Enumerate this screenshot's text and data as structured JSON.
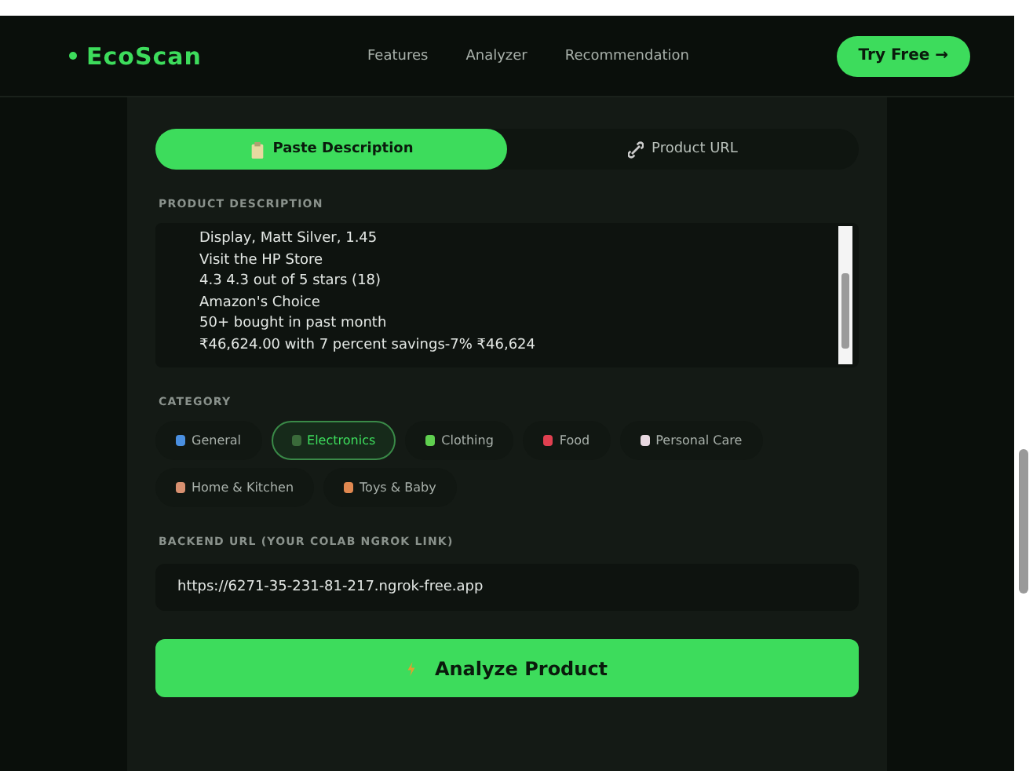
{
  "header": {
    "logo": "EcoScan",
    "nav": [
      "Features",
      "Analyzer",
      "Recommendation"
    ],
    "cta": "Try Free →"
  },
  "tabs": [
    {
      "label": "Paste Description",
      "selected": true
    },
    {
      "label": "Product URL",
      "selected": false
    }
  ],
  "description": {
    "label": "PRODUCT DESCRIPTION",
    "lines": [
      "Display, Matt Silver, 1.45",
      "Visit the HP Store",
      "4.3 4.3 out of 5 stars  (18)",
      "Amazon's Choice",
      "50+ bought in past month",
      "₹46,624.00 with 7 percent savings-7% ₹46,624"
    ]
  },
  "category": {
    "label": "CATEGORY",
    "chips": [
      {
        "label": "General",
        "selected": false
      },
      {
        "label": "Electronics",
        "selected": true
      },
      {
        "label": "Clothing",
        "selected": false
      },
      {
        "label": "Food",
        "selected": false
      },
      {
        "label": "Personal Care",
        "selected": false
      },
      {
        "label": "Home & Kitchen",
        "selected": false
      },
      {
        "label": "Toys & Baby",
        "selected": false
      }
    ]
  },
  "backend": {
    "label": "BACKEND URL (YOUR COLAB NGROK LINK)",
    "value": "https://6271-35-231-81-217.ngrok-free.app"
  },
  "analyze_button": "Analyze Product"
}
